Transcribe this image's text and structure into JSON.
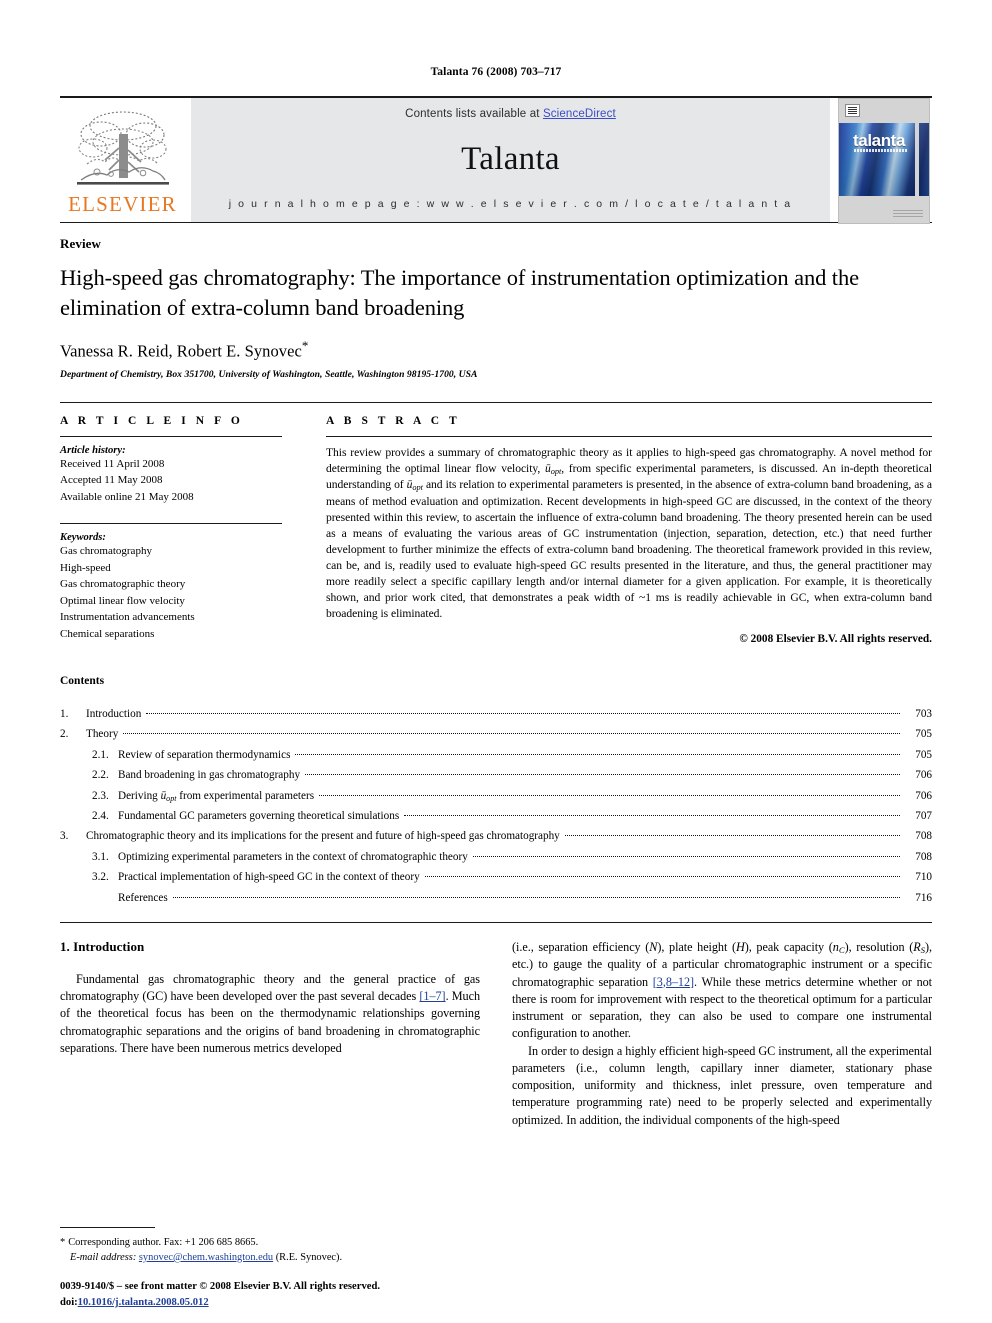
{
  "running_head": "Talanta 76 (2008) 703–717",
  "masthead": {
    "publisher_name": "ELSEVIER",
    "publisher_logo": "elsevier-tree-logo",
    "contents_line_prefix": "Contents lists available at ",
    "contents_line_link": "ScienceDirect",
    "journal_name": "Talanta",
    "homepage_line": "j o u r n a l   h o m e p a g e :   w w w . e l s e v i e r . c o m / l o c a t e / t a l a n t a",
    "cover_title": "talanta",
    "link_color": "#3b4cc8",
    "accent_color": "#E87722"
  },
  "article": {
    "doctype": "Review",
    "title": "High-speed gas chromatography: The importance of instrumentation optimization and the elimination of extra-column band broadening",
    "authors": "Vanessa R. Reid, Robert E. Synovec",
    "corresponding_marker": "*",
    "affiliation": "Department of Chemistry, Box 351700, University of Washington, Seattle, Washington 98195-1700, USA"
  },
  "article_info": {
    "heading": "A R T I C L E   I N F O",
    "history_label": "Article history:",
    "history": [
      "Received 11 April 2008",
      "Accepted 11 May 2008",
      "Available online 21 May 2008"
    ],
    "keywords_label": "Keywords:",
    "keywords": [
      "Gas chromatography",
      "High-speed",
      "Gas chromatographic theory",
      "Optimal linear flow velocity",
      "Instrumentation advancements",
      "Chemical separations"
    ]
  },
  "abstract": {
    "heading": "A B S T R A C T",
    "paragraphs": [
      "This review provides a summary of chromatographic theory as it applies to high-speed gas chromatography. A novel method for determining the optimal linear flow velocity, ū_opt, from specific experimental parameters, is discussed. An in-depth theoretical understanding of ū_opt and its relation to experimental parameters is presented, in the absence of extra-column band broadening, as a means of method evaluation and optimization. Recent developments in high-speed GC are discussed, in the context of the theory presented within this review, to ascertain the influence of extra-column band broadening. The theory presented herein can be used as a means of evaluating the various areas of GC instrumentation (injection, separation, detection, etc.) that need further development to further minimize the effects of extra-column band broadening. The theoretical framework provided in this review, can be, and is, readily used to evaluate high-speed GC results presented in the literature, and thus, the general practitioner may more readily select a specific capillary length and/or internal diameter for a given application. For example, it is theoretically shown, and prior work cited, that demonstrates a peak width of ~1 ms is readily achievable in GC, when extra-column band broadening is eliminated."
    ],
    "copyright": "© 2008 Elsevier B.V. All rights reserved."
  },
  "contents": {
    "heading": "Contents",
    "entries": [
      {
        "num": "1.",
        "level": 1,
        "label": "Introduction",
        "page": "703"
      },
      {
        "num": "2.",
        "level": 1,
        "label": "Theory",
        "page": "705"
      },
      {
        "num": "2.1.",
        "level": 2,
        "label": "Review of separation thermodynamics",
        "page": "705"
      },
      {
        "num": "2.2.",
        "level": 2,
        "label": "Band broadening in gas chromatography",
        "page": "706"
      },
      {
        "num": "2.3.",
        "level": 2,
        "label": "Deriving ū_opt from experimental parameters",
        "page": "706"
      },
      {
        "num": "2.4.",
        "level": 2,
        "label": "Fundamental GC parameters governing theoretical simulations",
        "page": "707"
      },
      {
        "num": "3.",
        "level": 1,
        "label": "Chromatographic theory and its implications for the present and future of high-speed gas chromatography",
        "page": "708"
      },
      {
        "num": "3.1.",
        "level": 2,
        "label": "Optimizing experimental parameters in the context of chromatographic theory",
        "page": "708"
      },
      {
        "num": "3.2.",
        "level": 2,
        "label": "Practical implementation of high-speed GC in the context of theory",
        "page": "710"
      },
      {
        "num": "",
        "level": 2,
        "label": "References",
        "page": "716"
      }
    ]
  },
  "body": {
    "section_heading": "1.  Introduction",
    "left_paragraph_1_a": "Fundamental gas chromatographic theory and the general practice of gas chromatography (GC) have been developed over the past several decades ",
    "left_paragraph_1_cite": "[1–7]",
    "left_paragraph_1_b": ". Much of the theoretical focus has been on the thermodynamic relationships governing chromatographic separations and the origins of band broadening in chromatographic separations. There have been numerous metrics developed",
    "right_paragraph_1_a": "(i.e., separation efficiency (",
    "right_var_N": "N",
    "right_paragraph_1_b": "), plate height (",
    "right_var_H": "H",
    "right_paragraph_1_c": "), peak capacity (",
    "right_var_nc": "n",
    "right_var_nc_sub": "C",
    "right_paragraph_1_d": "), resolution (",
    "right_var_rs": "R",
    "right_var_rs_sub": "S",
    "right_paragraph_1_e": "), etc.) to gauge the quality of a particular chromatographic instrument or a specific chromatographic separation ",
    "right_paragraph_1_cite": "[3,8–12]",
    "right_paragraph_1_f": ". While these metrics determine whether or not there is room for improvement with respect to the theoretical optimum for a particular instrument or separation, they can also be used to compare one instrumental configuration to another.",
    "right_paragraph_2": "In order to design a highly efficient high-speed GC instrument, all the experimental parameters (i.e., column length, capillary inner diameter, stationary phase composition, uniformity and thickness, inlet pressure, oven temperature and temperature programming rate) need to be properly selected and experimentally optimized. In addition, the individual components of the high-speed"
  },
  "footnotes": {
    "corresponding_mark": "*",
    "corresponding_text": "Corresponding author. Fax: +1 206 685 8665.",
    "email_label": "E-mail address:",
    "email_address": "synovec@chem.washington.edu",
    "email_suffix": " (R.E. Synovec).",
    "issn_line": "0039-9140/$ – see front matter © 2008 Elsevier B.V. All rights reserved.",
    "doi_label": "doi:",
    "doi_value": "10.1016/j.talanta.2008.05.012"
  }
}
